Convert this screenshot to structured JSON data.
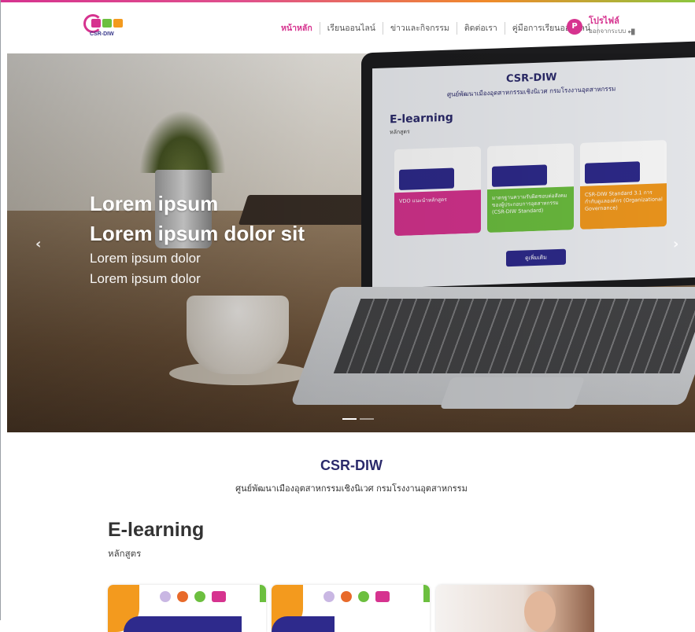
{
  "colors": {
    "brand_pink": "#d6338f",
    "navy": "#2b2a6b",
    "orange": "#f39a1e",
    "green": "#6cbf3f"
  },
  "header": {
    "logo_text": "CSR-DIW",
    "nav": [
      {
        "label": "หน้าหลัก",
        "active": true
      },
      {
        "label": "เรียนออนไลน์",
        "active": false
      },
      {
        "label": "ข่าวและกิจกรรม",
        "active": false
      },
      {
        "label": "ติดต่อเรา",
        "active": false
      },
      {
        "label": "คู่มือการเรียนออนไลน์",
        "active": false
      }
    ],
    "profile": {
      "avatar_letter": "P",
      "name": "โปรไฟล์",
      "logout": "ออกจากระบบ"
    }
  },
  "hero": {
    "line1": "Lorem ipsum",
    "line2": "Lorem ipsum dolor sit",
    "line3": "Lorem ipsum dolor",
    "line4": "Lorem ipsum dolor",
    "prev_icon": "chevron-left-icon",
    "next_icon": "chevron-right-icon",
    "screen": {
      "title": "CSR-DIW",
      "subtitle": "ศูนย์พัฒนาเมืองอุตสาหกรรมเชิงนิเวศ กรมโรงงานอุตสาหกรรม",
      "heading": "E-learning",
      "course": "หลักสูตร",
      "cards": [
        {
          "label": "VDO แนะนำหลักสูตร",
          "color": "#d6338f"
        },
        {
          "label": "มาตรฐานความรับผิดชอบต่อสังคมของผู้ประกอบการอุตสาหกรรม (CSR-DIW Standard)",
          "color": "#6cbf3f"
        },
        {
          "label": "CSR-DIW Standard 3.1 การกำกับดูแลองค์กร (Organizational Governance)",
          "color": "#f39a1e"
        }
      ],
      "more_button": "ดูเพิ่มเติม"
    }
  },
  "section": {
    "title": "CSR-DIW",
    "subtitle": "ศูนย์พัฒนาเมืองอุตสาหกรรมเชิงนิเวศ กรมโรงงานอุตสาหกรรม",
    "elearning_title": "E-learning",
    "elearning_sub": "หลักสูตร"
  }
}
